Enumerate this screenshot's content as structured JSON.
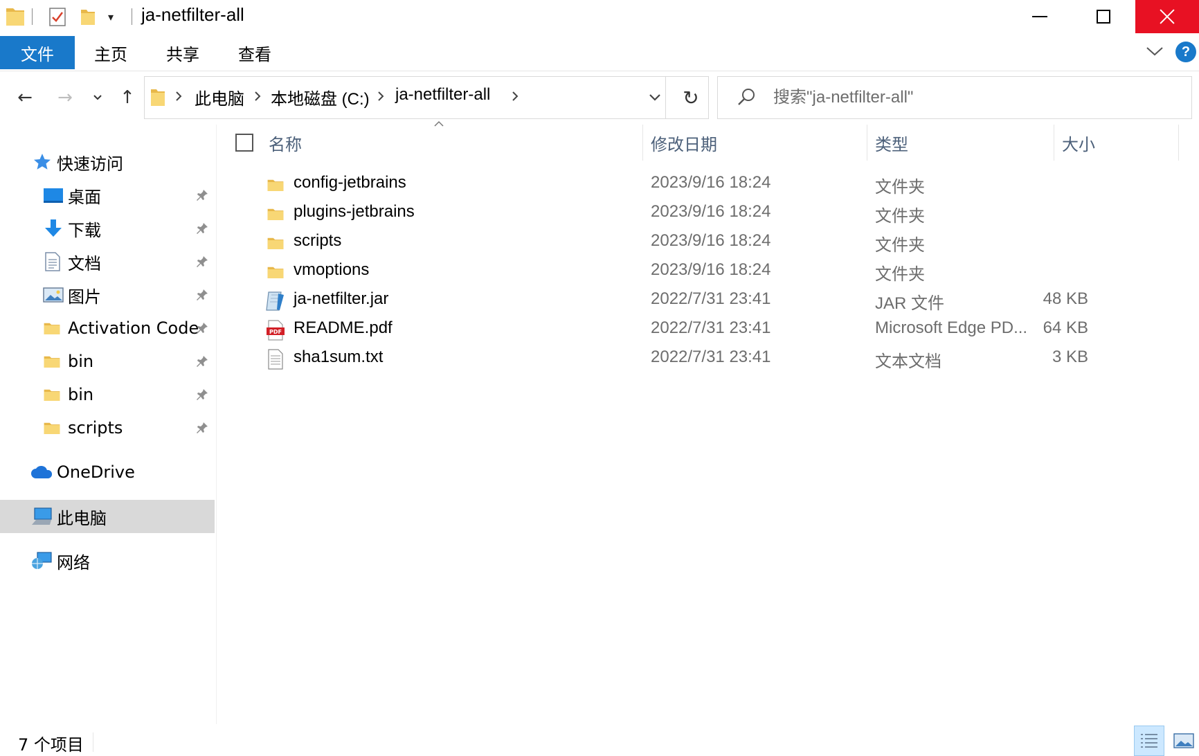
{
  "window": {
    "title": "ja-netfilter-all",
    "qat_dropdown": "▾"
  },
  "ribbon": {
    "file_tab": "文件",
    "tabs": [
      {
        "label": "主页"
      },
      {
        "label": "共享"
      },
      {
        "label": "查看"
      }
    ],
    "help_label": "?"
  },
  "nav": {
    "back": "←",
    "forward": "→",
    "recent": "⌄",
    "up": "↑",
    "refresh": "↻"
  },
  "breadcrumb": [
    {
      "label": "此电脑"
    },
    {
      "label": "本地磁盘 (C:)"
    },
    {
      "label": "ja-netfilter-all"
    }
  ],
  "search": {
    "placeholder": "搜索\"ja-netfilter-all\"",
    "value": ""
  },
  "sidebar": {
    "quick_access": "快速访问",
    "items": [
      {
        "label": "桌面",
        "icon": "desktop-icon",
        "pinned": true
      },
      {
        "label": "下载",
        "icon": "download-icon",
        "pinned": true
      },
      {
        "label": "文档",
        "icon": "document-icon",
        "pinned": true
      },
      {
        "label": "图片",
        "icon": "pictures-icon",
        "pinned": true
      },
      {
        "label": "Activation Code",
        "icon": "folder-icon",
        "pinned": true
      },
      {
        "label": "bin",
        "icon": "folder-icon",
        "pinned": true
      },
      {
        "label": "bin",
        "icon": "folder-icon",
        "pinned": true
      },
      {
        "label": "scripts",
        "icon": "folder-icon",
        "pinned": true
      }
    ],
    "onedrive": "OneDrive",
    "this_pc": "此电脑",
    "network": "网络"
  },
  "columns": {
    "name": "名称",
    "date": "修改日期",
    "type": "类型",
    "size": "大小"
  },
  "files": [
    {
      "name": "config-jetbrains",
      "date": "2023/9/16 18:24",
      "type": "文件夹",
      "size": "",
      "icon": "folder-icon"
    },
    {
      "name": "plugins-jetbrains",
      "date": "2023/9/16 18:24",
      "type": "文件夹",
      "size": "",
      "icon": "folder-icon"
    },
    {
      "name": "scripts",
      "date": "2023/9/16 18:24",
      "type": "文件夹",
      "size": "",
      "icon": "folder-icon"
    },
    {
      "name": "vmoptions",
      "date": "2023/9/16 18:24",
      "type": "文件夹",
      "size": "",
      "icon": "folder-icon"
    },
    {
      "name": "ja-netfilter.jar",
      "date": "2022/7/31 23:41",
      "type": "JAR 文件",
      "size": "48 KB",
      "icon": "jar-file-icon"
    },
    {
      "name": "README.pdf",
      "date": "2022/7/31 23:41",
      "type": "Microsoft Edge PD...",
      "size": "64 KB",
      "icon": "pdf-file-icon"
    },
    {
      "name": "sha1sum.txt",
      "date": "2022/7/31 23:41",
      "type": "文本文档",
      "size": "3 KB",
      "icon": "text-file-icon"
    }
  ],
  "status": {
    "item_count": "7 个项目"
  },
  "colors": {
    "accent": "#1979ca",
    "close": "#e81123",
    "header_text": "#4c607a",
    "selected_bg": "#d9d9d9",
    "folder": "#f8d775"
  }
}
